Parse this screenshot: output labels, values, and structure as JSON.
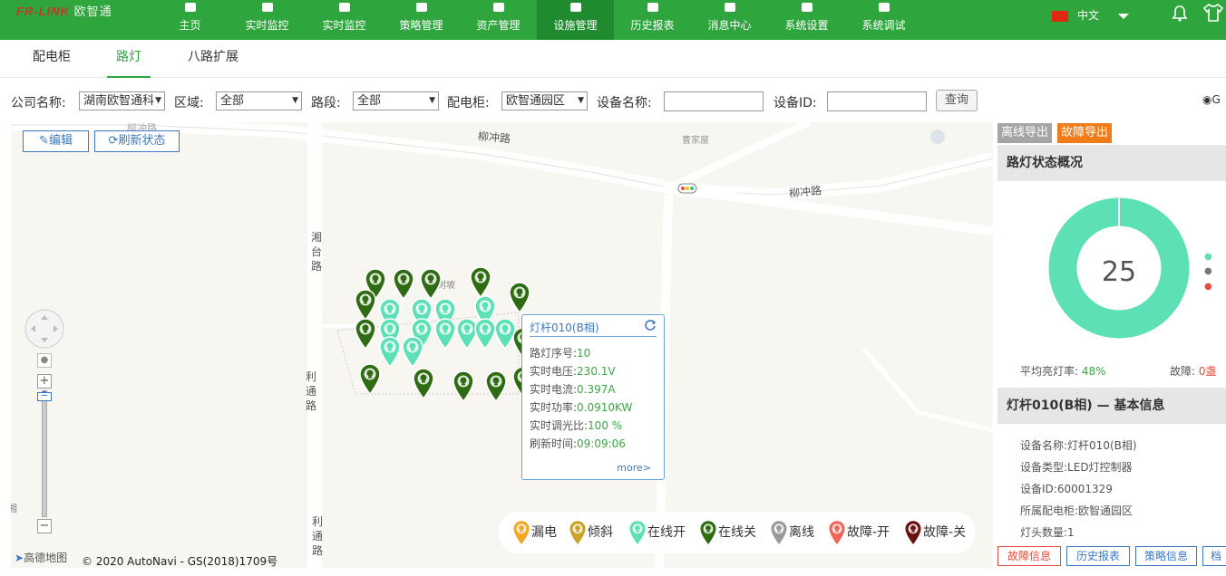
{
  "logo": {
    "text": "FR-LINK",
    "cn": "欧智通"
  },
  "nav": {
    "items": [
      {
        "label": "主页",
        "icon": "home-icon"
      },
      {
        "label": "实时监控",
        "icon": "monitor-icon"
      },
      {
        "label": "实时监控",
        "icon": "monitor-icon"
      },
      {
        "label": "策略管理",
        "icon": "policy-icon"
      },
      {
        "label": "资产管理",
        "icon": "asset-icon"
      },
      {
        "label": "设施管理",
        "icon": "tools-icon"
      },
      {
        "label": "历史报表",
        "icon": "report-icon"
      },
      {
        "label": "消息中心",
        "icon": "message-icon"
      },
      {
        "label": "系统设置",
        "icon": "gear-icon"
      },
      {
        "label": "系统调试",
        "icon": "debug-icon"
      }
    ],
    "language": "中文"
  },
  "subtabs": {
    "cabinet": "配电柜",
    "streetlight": "路灯",
    "ext8": "八路扩展"
  },
  "filters": {
    "company_label": "公司名称:",
    "company_value": "湖南欧智通科",
    "area_label": "区域:",
    "area_value": "全部",
    "road_label": "路段:",
    "road_value": "全部",
    "cabinet_label": "配电柜:",
    "cabinet_value": "欧智通园区",
    "device_name_label": "设备名称:",
    "device_name_value": "",
    "device_id_label": "设备ID:",
    "device_id_value": "",
    "query": "查询",
    "radio_label": "G"
  },
  "map": {
    "edit_btn": "编辑",
    "refresh_btn": "刷新状态",
    "labels": {
      "road1": "柳冲路",
      "road2": "柳冲路",
      "road3": "柳冲路",
      "xiang1": "湘",
      "xiang2": "台",
      "xiang3": "路",
      "li1": "利",
      "li2": "通",
      "li3": "路",
      "li4": "利",
      "li5": "通",
      "li6": "路",
      "village": "曹家屋",
      "slope": "树坡",
      "left_edge": "湘"
    },
    "copyright": "© 2020 AutoNavi - GS(2018)1709号",
    "provider": "高德地图"
  },
  "popup": {
    "title": "灯杆010(B相)",
    "rows": [
      {
        "label": "路灯序号:",
        "value": "10"
      },
      {
        "label": "实时电压:",
        "value": "230.1V"
      },
      {
        "label": "实时电流:",
        "value": "0.397A"
      },
      {
        "label": "实时功率:",
        "value": "0.0910KW"
      },
      {
        "label": "实时调光比:",
        "value": "100 %"
      },
      {
        "label": "刷新时间:",
        "value": "09:09:06"
      }
    ],
    "more": "more>"
  },
  "legend": [
    {
      "label": "漏电",
      "color": "#f5a623"
    },
    {
      "label": "倾斜",
      "color": "#c9a227"
    },
    {
      "label": "在线开",
      "color": "#5ee0b6"
    },
    {
      "label": "在线关",
      "color": "#2e6b12"
    },
    {
      "label": "离线",
      "color": "#9a9a9a"
    },
    {
      "label": "故障-开",
      "color": "#f0645a"
    },
    {
      "label": "故障-关",
      "color": "#6b0f0f"
    }
  ],
  "right": {
    "offline_export": "离线导出",
    "fault_export": "故障导出",
    "overview_title": "路灯状态概况",
    "total": "25",
    "avg_label": "平均亮灯率:",
    "avg_value": "48%",
    "fault_label": "故障:",
    "fault_value": "0盏",
    "info_title": "灯杆010(B相) — 基本信息",
    "info": [
      {
        "label": "设备名称:",
        "value": "灯杆010(B相)"
      },
      {
        "label": "设备类型:",
        "value": "LED灯控制器"
      },
      {
        "label": "设备ID:",
        "value": "60001329"
      },
      {
        "label": "所属配电柜:",
        "value": "欧智通园区"
      },
      {
        "label": "灯头数量:",
        "value": "1"
      }
    ],
    "buttons": [
      "故障信息",
      "历史报表",
      "策略信息",
      "档"
    ]
  },
  "chart_data": {
    "type": "pie",
    "values": [
      25
    ],
    "colors": [
      "#5ee0b6"
    ],
    "center_label": "25"
  }
}
